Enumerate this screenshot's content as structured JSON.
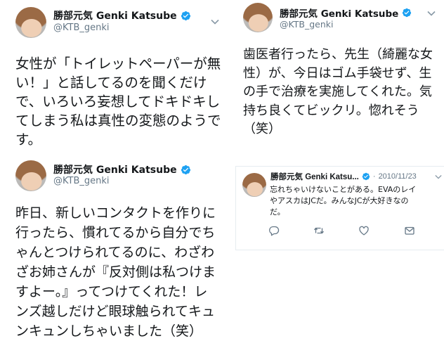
{
  "tweets": [
    {
      "name": "勝部元気 Genki Katsube",
      "handle": "@KTB_genki",
      "lines": [
        "女性が「トイレットペーパーが無",
        "い！」と話してるのを聞くだけ",
        "で、いろいろ妄想してドキドキし",
        "てしまう私は真性の変態のようで",
        "す。"
      ]
    },
    {
      "name": "勝部元気 Genki Katsube",
      "handle": "@KTB_genki",
      "lines": [
        "歯医者行ったら、先生（綺麗な女",
        "性）が、今日はゴム手袋せず、生",
        "の手で治療を実施してくれた。気",
        "持ち良くてビックリ。惚れそう",
        "（笑）"
      ]
    },
    {
      "name": "勝部元気 Genki Katsube",
      "handle": "@KTB_genki",
      "lines": [
        "昨日、新しいコンタクトを作りに",
        "行ったら、慣れてるから自分でち",
        "ゃんとつけられてるのに、わざわ",
        "ざお姉さんが『反対側は私つけま",
        "すよー。』ってつけてくれた！レ",
        "ンズ越しだけど眼球触られてキュ",
        "ンキュンしちゃいました（笑）"
      ]
    }
  ],
  "old_tweet": {
    "name": "勝部元気 Genki Katsu...",
    "separator": "·",
    "date": "2010/11/23",
    "lines": [
      "忘れちゃいけないことがある。EVAのレイ",
      "やアスカはJCだ。みんなJCが大好きなの",
      "だ。"
    ],
    "actions": [
      "reply-icon",
      "retweet-icon",
      "like-icon",
      "direct-message-icon"
    ]
  },
  "icons": {
    "verified": "verified-badge-icon",
    "menu": "chevron-down-icon",
    "avatar": "profile-photo"
  },
  "colors": {
    "text": "#14171a",
    "muted": "#657786",
    "verified": "#1da1f2",
    "border": "#e6ecf0"
  }
}
